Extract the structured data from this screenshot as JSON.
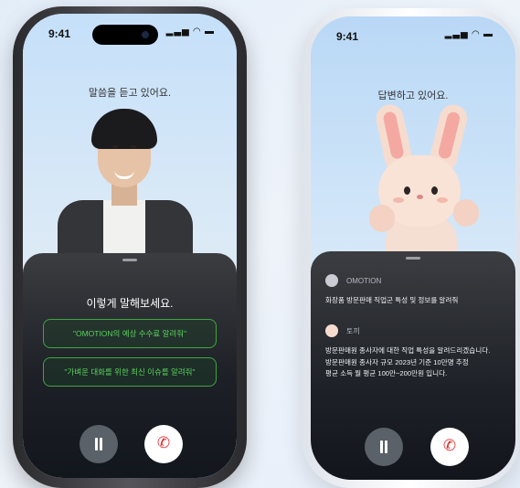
{
  "phone_left": {
    "status_time": "9:41",
    "listening_text": "말씀을 듣고 있어요.",
    "sheet_title": "이렇게 말해보세요.",
    "suggestions": [
      "\"OMOTION의 예상 수수료 알려줘\"",
      "\"가벼운 대화를 위한 최신 이슈를 알려줘\""
    ]
  },
  "phone_right": {
    "status_time": "9:41",
    "answering_text": "답변하고 있어요.",
    "messages": [
      {
        "sender": "OMOTION",
        "text": "화장품 방문판매 직업군 특성 및 정보를 알려줘"
      },
      {
        "sender": "토끼",
        "text": "방문판매원 종사자에 대한 직업 특성을 알려드리겠습니다.\n방문판매원 종사자 규모 2023년 기준 10만명 추정\n평균 소득 월 평균 100만~200만원 입니다."
      }
    ]
  },
  "icons": {
    "signal": "signal-icon",
    "wifi": "wifi-icon",
    "battery": "battery-icon",
    "pause": "pause-icon",
    "end_call": "phone-end-icon"
  },
  "colors": {
    "suggestion_green": "#59d05b",
    "end_call_red": "#e22c2c"
  }
}
